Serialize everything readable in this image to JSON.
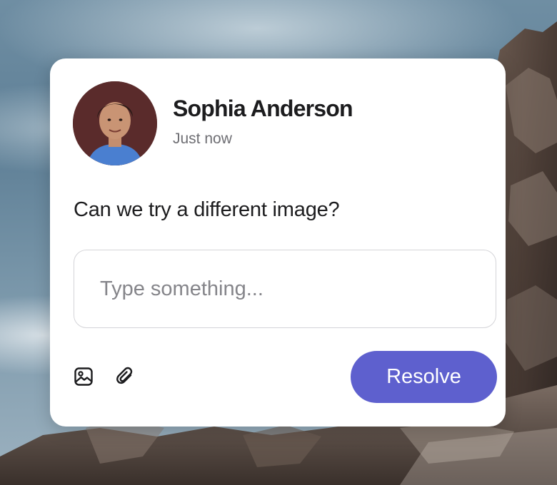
{
  "comment": {
    "author": "Sophia Anderson",
    "timestamp": "Just now",
    "text": "Can we try a different image?"
  },
  "reply": {
    "placeholder": "Type something...",
    "value": ""
  },
  "actions": {
    "image_icon": "image-icon",
    "attach_icon": "paperclip-icon",
    "resolve_label": "Resolve"
  },
  "colors": {
    "accent": "#5e60ce",
    "card": "#ffffff",
    "text": "#1c1c1e",
    "muted": "#6e6e73"
  }
}
